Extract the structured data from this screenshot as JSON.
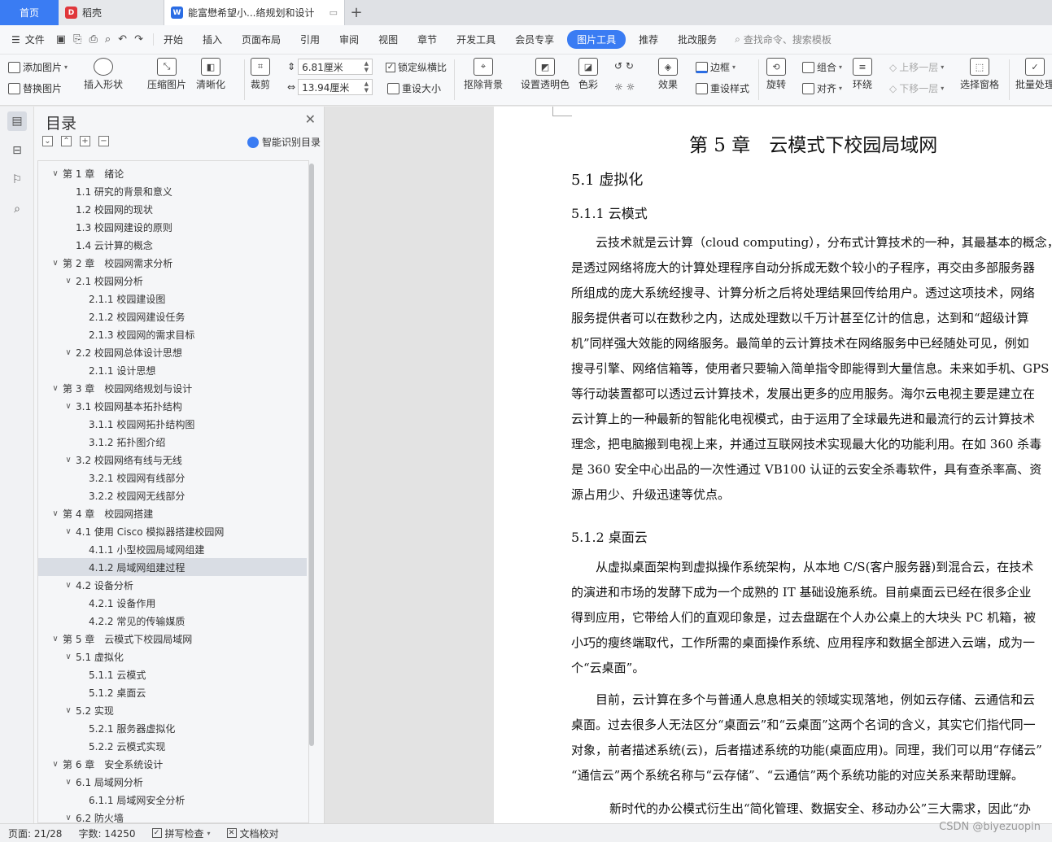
{
  "tabs": {
    "home": "首页",
    "docer": "稻壳",
    "doc": "能富懋希望小...络规划和设计"
  },
  "menubar": {
    "file": "文件",
    "items": [
      "开始",
      "插入",
      "页面布局",
      "引用",
      "审阅",
      "视图",
      "章节",
      "开发工具",
      "会员专享",
      "图片工具",
      "推荐",
      "批改服务"
    ],
    "search": "查找命令、搜索模板"
  },
  "ribbon": {
    "add_image": "添加图片",
    "replace_image": "替换图片",
    "insert_shape": "插入形状",
    "compress": "压缩图片",
    "sharpen": "清晰化",
    "crop": "裁剪",
    "width": "6.81厘米",
    "height": "13.94厘米",
    "lock_ratio": "锁定纵横比",
    "reset_size": "重设大小",
    "remove_bg": "抠除背景",
    "set_transparent": "设置透明色",
    "color": "色彩",
    "effect": "效果",
    "border": "边框",
    "reset_style": "重设样式",
    "rotate": "旋转",
    "group": "组合",
    "align": "对齐",
    "wrap": "环绕",
    "bring_forward": "上移一层",
    "send_backward": "下移一层",
    "select_pane": "选择窗格",
    "batch": "批量处理"
  },
  "toc": {
    "title": "目录",
    "smart": "智能识别目录",
    "items": [
      {
        "text": "第 1 章　绪论",
        "level": 1,
        "toggle": "∨"
      },
      {
        "text": "1.1  研究的背景和意义",
        "level": 2,
        "toggle": ""
      },
      {
        "text": "1.2  校园网的现状",
        "level": 2,
        "toggle": ""
      },
      {
        "text": "1.3  校园网建设的原则",
        "level": 2,
        "toggle": ""
      },
      {
        "text": "1.4  云计算的概念",
        "level": 2,
        "toggle": ""
      },
      {
        "text": "第 2 章　校园网需求分析",
        "level": 1,
        "toggle": "∨"
      },
      {
        "text": "2.1  校园网分析",
        "level": 2,
        "toggle": "∨"
      },
      {
        "text": "2.1.1  校园建设图",
        "level": 3,
        "toggle": ""
      },
      {
        "text": "2.1.2  校园网建设任务",
        "level": 3,
        "toggle": ""
      },
      {
        "text": "2.1.3  校园网的需求目标",
        "level": 3,
        "toggle": ""
      },
      {
        "text": "2.2  校园网总体设计思想",
        "level": 2,
        "toggle": "∨"
      },
      {
        "text": "2.1.1  设计思想",
        "level": 3,
        "toggle": ""
      },
      {
        "text": "第 3 章　校园网络规划与设计",
        "level": 1,
        "toggle": "∨"
      },
      {
        "text": "3.1  校园网基本拓扑结构",
        "level": 2,
        "toggle": "∨"
      },
      {
        "text": "3.1.1  校园网拓扑结构图",
        "level": 3,
        "toggle": ""
      },
      {
        "text": "3.1.2  拓扑图介绍",
        "level": 3,
        "toggle": ""
      },
      {
        "text": "3.2  校园网络有线与无线",
        "level": 2,
        "toggle": "∨"
      },
      {
        "text": "3.2.1  校园网有线部分",
        "level": 3,
        "toggle": ""
      },
      {
        "text": "3.2.2  校园网无线部分",
        "level": 3,
        "toggle": ""
      },
      {
        "text": "第 4 章　校园网搭建",
        "level": 1,
        "toggle": "∨"
      },
      {
        "text": "4.1  使用 Cisco 模拟器搭建校园网",
        "level": 2,
        "toggle": "∨"
      },
      {
        "text": "4.1.1  小型校园局域网组建",
        "level": 3,
        "toggle": ""
      },
      {
        "text": "4.1.2  局域网组建过程",
        "level": 3,
        "toggle": "",
        "selected": true
      },
      {
        "text": "4.2  设备分析",
        "level": 2,
        "toggle": "∨"
      },
      {
        "text": "4.2.1  设备作用",
        "level": 3,
        "toggle": ""
      },
      {
        "text": "4.2.2 常见的传输媒质",
        "level": 3,
        "toggle": ""
      },
      {
        "text": "第 5 章　云模式下校园局域网",
        "level": 1,
        "toggle": "∨"
      },
      {
        "text": "5.1  虚拟化",
        "level": 2,
        "toggle": "∨"
      },
      {
        "text": "5.1.1  云模式",
        "level": 3,
        "toggle": ""
      },
      {
        "text": "5.1.2  桌面云",
        "level": 3,
        "toggle": ""
      },
      {
        "text": "5.2  实现",
        "level": 2,
        "toggle": "∨"
      },
      {
        "text": "5.2.1  服务器虚拟化",
        "level": 3,
        "toggle": ""
      },
      {
        "text": "5.2.2  云模式实现",
        "level": 3,
        "toggle": ""
      },
      {
        "text": "第 6 章　安全系统设计",
        "level": 1,
        "toggle": "∨"
      },
      {
        "text": "6.1  局域网分析",
        "level": 2,
        "toggle": "∨"
      },
      {
        "text": "6.1.1  局域网安全分析",
        "level": 3,
        "toggle": ""
      },
      {
        "text": "6.2  防火墙",
        "level": 2,
        "toggle": "∨"
      }
    ]
  },
  "doc": {
    "chapter": "第 5 章　云模式下校园局域网",
    "h51": "5.1  虚拟化",
    "h511": "5.1.1  云模式",
    "para1": [
      "云技术就是云计算（cloud computing），分布式计算技术的一种，其最基本的概念，",
      "是透过网络将庞大的计算处理程序自动分拆成无数个较小的子程序，再交由多部服务器",
      "所组成的庞大系统经搜寻、计算分析之后将处理结果回传给用户。透过这项技术，网络",
      "服务提供者可以在数秒之内，达成处理数以千万计甚至亿计的信息，达到和“超级计算",
      "机”同样强大效能的网络服务。最简单的云计算技术在网络服务中已经随处可见，例如",
      "搜寻引擎、网络信箱等，使用者只要输入简单指令即能得到大量信息。未来如手机、GPS",
      "等行动装置都可以透过云计算技术，发展出更多的应用服务。海尔云电视主要是建立在",
      "云计算上的一种最新的智能化电视模式，由于运用了全球最先进和最流行的云计算技术",
      "理念，把电脑搬到电视上来，并通过互联网技术实现最大化的功能利用。在如 360 杀毒",
      "是 360 安全中心出品的一次性通过 VB100 认证的云安全杀毒软件，具有查杀率高、资",
      "源占用少、升级迅速等优点。"
    ],
    "h512": "5.1.2  桌面云",
    "para2": [
      "从虚拟桌面架构到虚拟操作系统架构，从本地 C/S(客户服务器)到混合云，在技术",
      "的演进和市场的发酵下成为一个成熟的 IT 基础设施系统。目前桌面云已经在很多企业",
      "得到应用，它带给人们的直观印象是，过去盘踞在个人办公桌上的大块头 PC 机箱，被",
      "小巧的瘦终端取代，工作所需的桌面操作系统、应用程序和数据全部进入云端，成为一",
      "个“云桌面”。"
    ],
    "para3": [
      "目前，云计算在多个与普通人息息相关的领域实现落地，例如云存储、云通信和云",
      "桌面。过去很多人无法区分“桌面云”和“云桌面”这两个名词的含义，其实它们指代同一",
      "对象，前者描述系统(云)，后者描述系统的功能(桌面应用)。同理，我们可以用“存储云”",
      "“通信云”两个系统名称与“云存储”、“云通信”两个系统功能的对应关系来帮助理解。"
    ],
    "para4": "新时代的办公模式衍生出“简化管理、数据安全、移动办公”三大需求，因此“办"
  },
  "status": {
    "page": "页面: 21/28",
    "words": "字数: 14250",
    "spell": "拼写检查",
    "proof": "文档校对",
    "watermark": "CSDN @biyezuopin"
  }
}
